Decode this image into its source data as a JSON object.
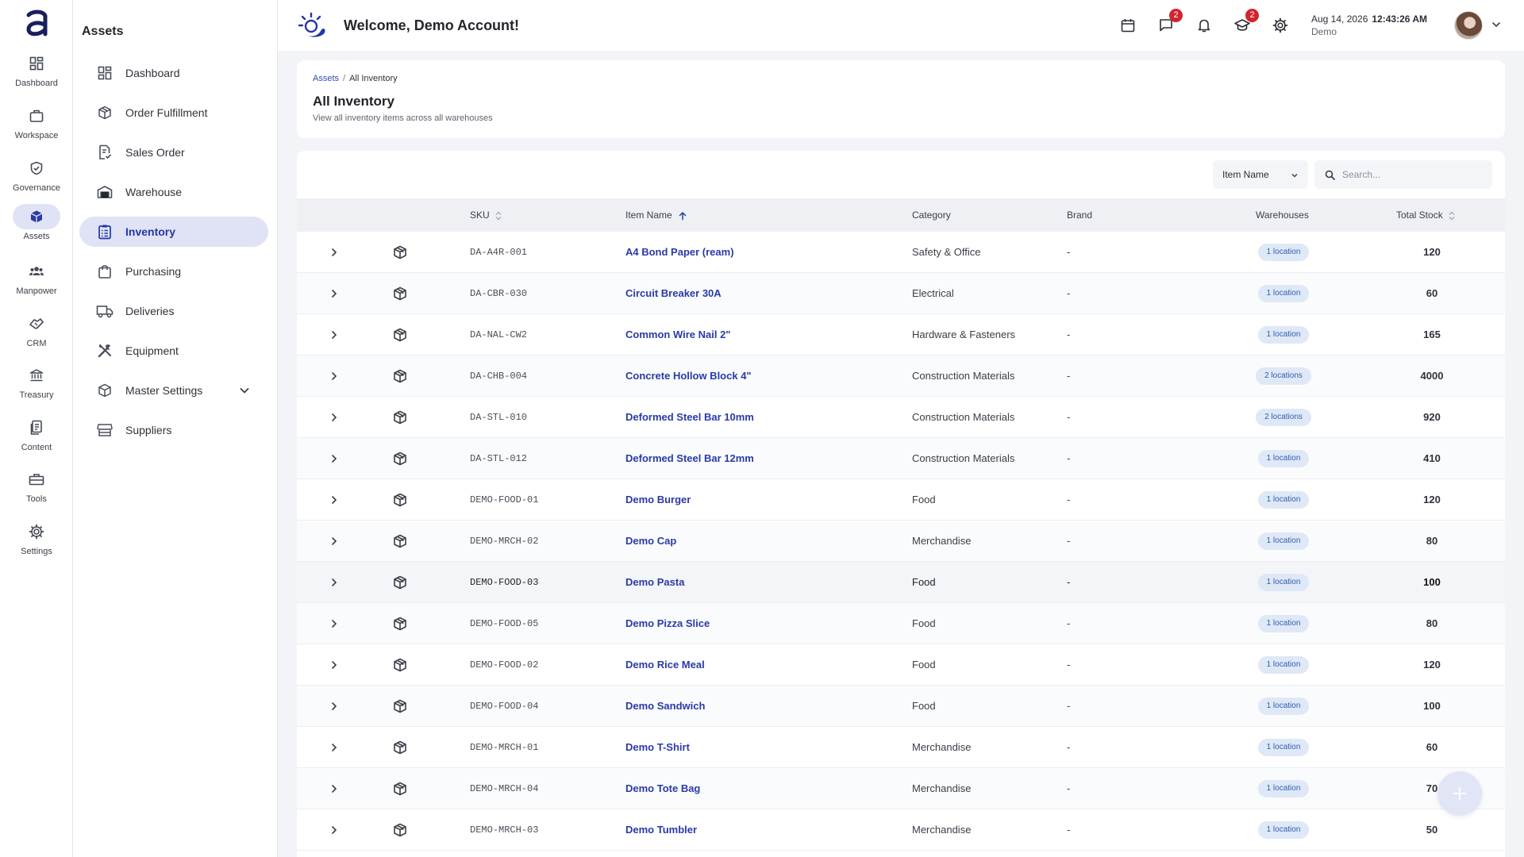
{
  "rail": {
    "items": [
      {
        "label": "Dashboard",
        "icon": "dashboard-icon"
      },
      {
        "label": "Workspace",
        "icon": "briefcase-icon"
      },
      {
        "label": "Governance",
        "icon": "shield-check-icon"
      },
      {
        "label": "Assets",
        "icon": "cube-icon",
        "active": true
      },
      {
        "label": "Manpower",
        "icon": "people-icon"
      },
      {
        "label": "CRM",
        "icon": "handshake-icon"
      },
      {
        "label": "Treasury",
        "icon": "bank-icon"
      },
      {
        "label": "Content",
        "icon": "document-icon"
      },
      {
        "label": "Tools",
        "icon": "toolbox-icon"
      },
      {
        "label": "Settings",
        "icon": "gear-icon"
      }
    ]
  },
  "sidebar": {
    "title": "Assets",
    "items": [
      {
        "label": "Dashboard",
        "icon": "dashboard-icon"
      },
      {
        "label": "Order Fulfillment",
        "icon": "package-icon"
      },
      {
        "label": "Sales Order",
        "icon": "document-check-icon"
      },
      {
        "label": "Warehouse",
        "icon": "warehouse-icon"
      },
      {
        "label": "Inventory",
        "icon": "clipboard-list-icon",
        "active": true
      },
      {
        "label": "Purchasing",
        "icon": "shopping-bag-icon"
      },
      {
        "label": "Deliveries",
        "icon": "truck-icon"
      },
      {
        "label": "Equipment",
        "icon": "tools-icon"
      },
      {
        "label": "Master Settings",
        "icon": "cube-icon",
        "has_children": true
      },
      {
        "label": "Suppliers",
        "icon": "store-icon"
      }
    ]
  },
  "header": {
    "welcome": "Welcome, Demo Account!",
    "messages_badge": "2",
    "learning_badge": "2",
    "date": "Aug 14, 2026",
    "time": "12:43:26 AM",
    "organization": "Demo"
  },
  "page": {
    "breadcrumb_root": "Assets",
    "breadcrumb_current": "All Inventory",
    "title": "All Inventory",
    "subtitle": "View all inventory items across all warehouses"
  },
  "filter": {
    "selected": "Item Name",
    "search_placeholder": "Search..."
  },
  "table": {
    "columns": {
      "sku": "SKU",
      "item_name": "Item Name",
      "category": "Category",
      "brand": "Brand",
      "warehouses": "Warehouses",
      "total_stock": "Total Stock"
    },
    "rows": [
      {
        "sku": "DA-A4R-001",
        "name": "A4 Bond Paper (ream)",
        "category": "Safety & Office",
        "brand": "-",
        "warehouses": "1 location",
        "stock": "120"
      },
      {
        "sku": "DA-CBR-030",
        "name": "Circuit Breaker 30A",
        "category": "Electrical",
        "brand": "-",
        "warehouses": "1 location",
        "stock": "60"
      },
      {
        "sku": "DA-NAL-CW2",
        "name": "Common Wire Nail 2\"",
        "category": "Hardware & Fasteners",
        "brand": "-",
        "warehouses": "1 location",
        "stock": "165"
      },
      {
        "sku": "DA-CHB-004",
        "name": "Concrete Hollow Block 4\"",
        "category": "Construction Materials",
        "brand": "-",
        "warehouses": "2 locations",
        "stock": "4000"
      },
      {
        "sku": "DA-STL-010",
        "name": "Deformed Steel Bar 10mm",
        "category": "Construction Materials",
        "brand": "-",
        "warehouses": "2 locations",
        "stock": "920"
      },
      {
        "sku": "DA-STL-012",
        "name": "Deformed Steel Bar 12mm",
        "category": "Construction Materials",
        "brand": "-",
        "warehouses": "1 location",
        "stock": "410"
      },
      {
        "sku": "DEMO-FOOD-01",
        "name": "Demo Burger",
        "category": "Food",
        "brand": "-",
        "warehouses": "1 location",
        "stock": "120"
      },
      {
        "sku": "DEMO-MRCH-02",
        "name": "Demo Cap",
        "category": "Merchandise",
        "brand": "-",
        "warehouses": "1 location",
        "stock": "80"
      },
      {
        "sku": "DEMO-FOOD-03",
        "name": "Demo Pasta",
        "category": "Food",
        "brand": "-",
        "warehouses": "1 location",
        "stock": "100"
      },
      {
        "sku": "DEMO-FOOD-05",
        "name": "Demo Pizza Slice",
        "category": "Food",
        "brand": "-",
        "warehouses": "1 location",
        "stock": "80"
      },
      {
        "sku": "DEMO-FOOD-02",
        "name": "Demo Rice Meal",
        "category": "Food",
        "brand": "-",
        "warehouses": "1 location",
        "stock": "120"
      },
      {
        "sku": "DEMO-FOOD-04",
        "name": "Demo Sandwich",
        "category": "Food",
        "brand": "-",
        "warehouses": "1 location",
        "stock": "100"
      },
      {
        "sku": "DEMO-MRCH-01",
        "name": "Demo T-Shirt",
        "category": "Merchandise",
        "brand": "-",
        "warehouses": "1 location",
        "stock": "60"
      },
      {
        "sku": "DEMO-MRCH-04",
        "name": "Demo Tote Bag",
        "category": "Merchandise",
        "brand": "-",
        "warehouses": "1 location",
        "stock": "70"
      },
      {
        "sku": "DEMO-MRCH-03",
        "name": "Demo Tumbler",
        "category": "Merchandise",
        "brand": "-",
        "warehouses": "1 location",
        "stock": "50"
      }
    ]
  },
  "colors": {
    "accent": "#2a3aa8",
    "active_bg": "#dfe3f5",
    "badge": "#d0252f",
    "pill_bg": "#dfe8f6",
    "pill_text": "#2f5fb2"
  }
}
